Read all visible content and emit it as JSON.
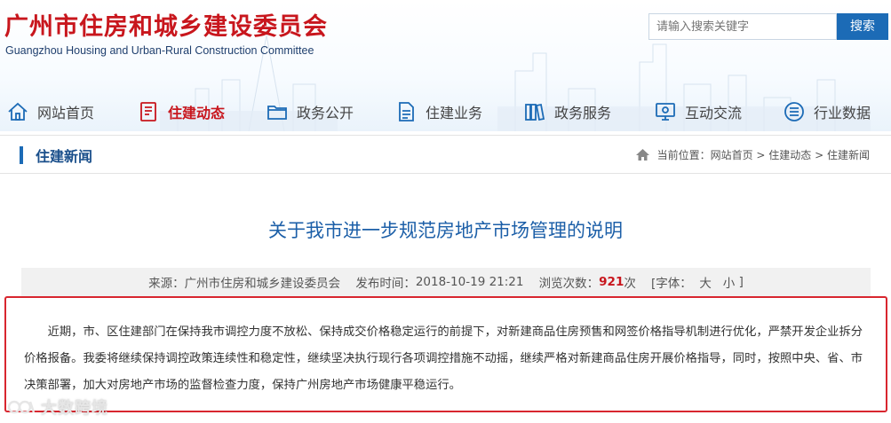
{
  "header": {
    "title_cn": "广州市住房和城乡建设委员会",
    "title_en": "Guangzhou Housing and Urban-Rural Construction Committee",
    "search_placeholder": "请输入搜索关键字",
    "search_button": "搜索"
  },
  "nav": {
    "items": [
      {
        "label": "网站首页",
        "icon": "home-icon"
      },
      {
        "label": "住建动态",
        "icon": "document-icon",
        "active": true
      },
      {
        "label": "政务公开",
        "icon": "folder-icon"
      },
      {
        "label": "住建业务",
        "icon": "file-icon"
      },
      {
        "label": "政务服务",
        "icon": "books-icon"
      },
      {
        "label": "互动交流",
        "icon": "monitor-icon"
      },
      {
        "label": "行业数据",
        "icon": "list-icon"
      }
    ]
  },
  "section": {
    "title": "住建新闻",
    "breadcrumb": {
      "prefix": "当前位置：",
      "items": [
        "网站首页",
        "住建动态",
        "住建新闻"
      ],
      "separator": " > "
    }
  },
  "article": {
    "title": "关于我市进一步规范房地产市场管理的说明",
    "meta": {
      "source_label": "来源：",
      "source": "广州市住房和城乡建设委员会",
      "date_label": "发布时间：",
      "date": "2018-10-19 21:21",
      "views_label": "浏览次数：",
      "views": "921",
      "views_unit": "次",
      "font_label": "[字体：",
      "font_large": "大",
      "font_small": "小",
      "font_close": "]"
    },
    "body": "近期，市、区住建部门在保持我市调控力度不放松、保持成交价格稳定运行的前提下，对新建商品住房预售和网签价格指导机制进行优化，严禁开发企业拆分价格报备。我委将继续保持调控政策连续性和稳定性，继续坚决执行现行各项调控措施不动摇，继续严格对新建商品住房开展价格指导，同时，按照中央、省、市决策部署，加大对房地产市场的监督检查力度，保持广州房地产市场健康平稳运行。"
  },
  "watermark": "大数跨境",
  "colors": {
    "brand_red": "#c8161d",
    "brand_blue": "#1c6bb6",
    "title_blue": "#1c5fa8",
    "highlight_border": "#d8262f"
  }
}
